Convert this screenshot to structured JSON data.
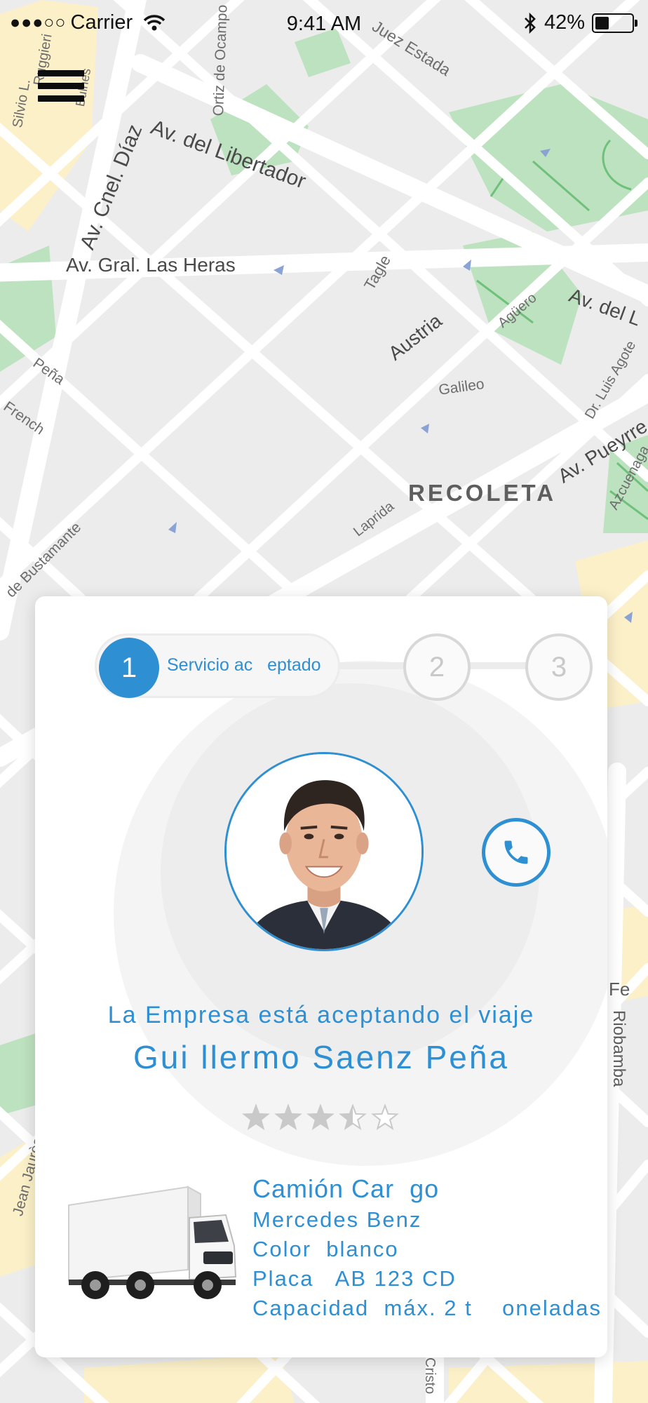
{
  "status_bar": {
    "carrier": "Carrier",
    "time": "9:41 AM",
    "battery": "42%",
    "battery_level": 0.42
  },
  "map": {
    "labels": [
      "Juez Estada",
      "Ortiz de Ocampo",
      "Av. del Libertador",
      "Av. Cnel. Díaz",
      "Av. Gral. Las Heras",
      "Tagle",
      "Austria",
      "Agüero",
      "Av. del L",
      "Galileo",
      "Dr. Luis Agote",
      "Av. Pueyrre",
      "Azcuenaga",
      "RECOLETA",
      "Laprida",
      "Peña",
      "French",
      "de Bustamante",
      "Riobamba",
      "Jean Jaurès",
      "Cristo",
      "Fe",
      "Ruggieri",
      "Silvio L.",
      "Bulnes"
    ]
  },
  "progress": {
    "step1_number": "1",
    "step1_label": "Servicio ac   eptado",
    "step2_number": "2",
    "step3_number": "3"
  },
  "card": {
    "status_text": "La Empresa está aceptando el viaje",
    "driver_name": "Gui llermo Saenz Peña",
    "rating": 3.5,
    "rating_max": 5
  },
  "vehicle": {
    "title": "Camión Car  go",
    "brand": "Mercedes Benz",
    "color": "Color  blanco",
    "plate": "Placa   AB 123 CD",
    "capacity": "Capacidad  máx. 2 t    oneladas"
  },
  "colors": {
    "accent": "#2e8fd3",
    "map_background": "#ececec",
    "park": "#bfe3c0",
    "road": "#ffffff",
    "highlight_block": "#fdf1c4"
  },
  "icons": [
    "menu-icon",
    "wifi-icon",
    "bluetooth-icon",
    "battery-icon",
    "phone-icon",
    "star-icon",
    "truck-image",
    "driver-photo"
  ]
}
